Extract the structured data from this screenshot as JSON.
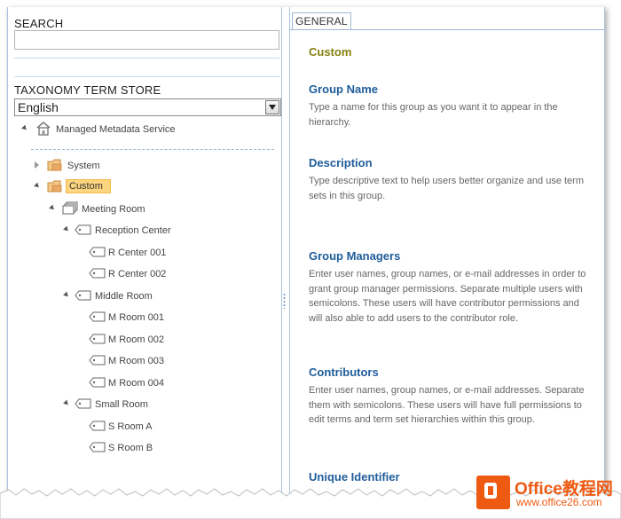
{
  "left": {
    "search_label": "SEARCH",
    "search_value": "",
    "store_label": "TAXONOMY TERM STORE",
    "language": "English",
    "tree": {
      "root": "Managed Metadata Service",
      "system": "System",
      "custom": "Custom",
      "meeting_room": "Meeting Room",
      "reception_center": "Reception Center",
      "r_center_001": "R Center 001",
      "r_center_002": "R Center 002",
      "middle_room": "Middle Room",
      "m_room_001": "M Room 001",
      "m_room_002": "M Room 002",
      "m_room_003": "M Room 003",
      "m_room_004": "M Room 004",
      "small_room": "Small Room",
      "s_room_a": "S Room A",
      "s_room_b": "S Room B"
    }
  },
  "right": {
    "tab": "GENERAL",
    "group_title": "Custom",
    "fields": {
      "group_name_h": "Group Name",
      "group_name_d": "Type a name for this group as you want it to appear in the hierarchy.",
      "description_h": "Description",
      "description_d": "Type descriptive text to help users better organize and use term sets in this group.",
      "group_managers_h": "Group Managers",
      "group_managers_d": "Enter user names, group names, or e-mail addresses in order to grant group manager permissions. Separate multiple users with semicolons. These users will have contributor permissions and will also able to add users to the contributor role.",
      "contributors_h": "Contributors",
      "contributors_d": "Enter user names, group names, or e-mail addresses. Separate them with semicolons. These users will have full permissions to edit terms and term set hierarchies within this group.",
      "unique_id_h": "Unique Identifier"
    }
  },
  "watermark": {
    "line1": "Office教程网",
    "line2": "www.office26.com"
  },
  "colors": {
    "accent_blue": "#1f5d9b",
    "group_title": "#85800f",
    "selection": "#fdd57f",
    "watermark": "#ee5a12"
  }
}
